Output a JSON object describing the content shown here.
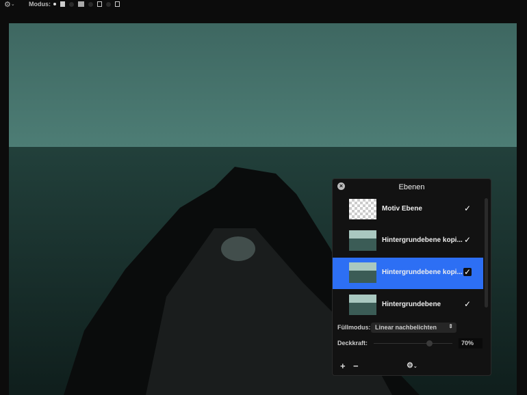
{
  "toolbar": {
    "settings_icon": "gear-icon",
    "mode_label": "Modus:"
  },
  "panel": {
    "title": "Ebenen",
    "layers": [
      {
        "name": "Motiv Ebene",
        "visible": true,
        "selected": false
      },
      {
        "name": "Hintergrundebene kopi...",
        "visible": true,
        "selected": false
      },
      {
        "name": "Hintergrundebene kopi...",
        "visible": true,
        "selected": true
      },
      {
        "name": "Hintergrundebene",
        "visible": true,
        "selected": false
      }
    ],
    "blend_label": "Füllmodus:",
    "blend_value": "Linear nachbelichten",
    "opacity_label": "Deckkraft:",
    "opacity_value": "70%",
    "opacity_fraction": 0.7,
    "add": "+",
    "remove": "−",
    "check": "✓"
  },
  "colors": {
    "selection": "#2d6ff4"
  }
}
